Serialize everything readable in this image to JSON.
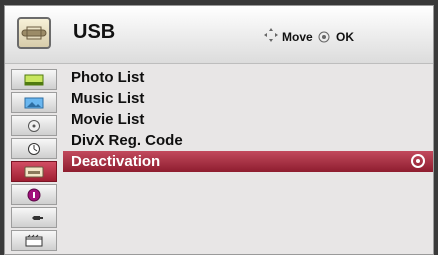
{
  "header": {
    "title": "USB",
    "hint_move": "Move",
    "hint_ok": "OK"
  },
  "menu": {
    "items": [
      {
        "label": "Photo List"
      },
      {
        "label": "Music List"
      },
      {
        "label": "Movie List"
      },
      {
        "label": "DivX Reg. Code"
      },
      {
        "label": "Deactivation",
        "selected": true
      }
    ]
  },
  "sidebar": {
    "icons": [
      "picture-icon",
      "photo-icon",
      "disc-icon",
      "clock-icon",
      "usb-icon",
      "info-icon",
      "plug-icon",
      "film-icon"
    ]
  },
  "colors": {
    "accent": "#a52a3c",
    "panel": "#e8e6e6"
  }
}
